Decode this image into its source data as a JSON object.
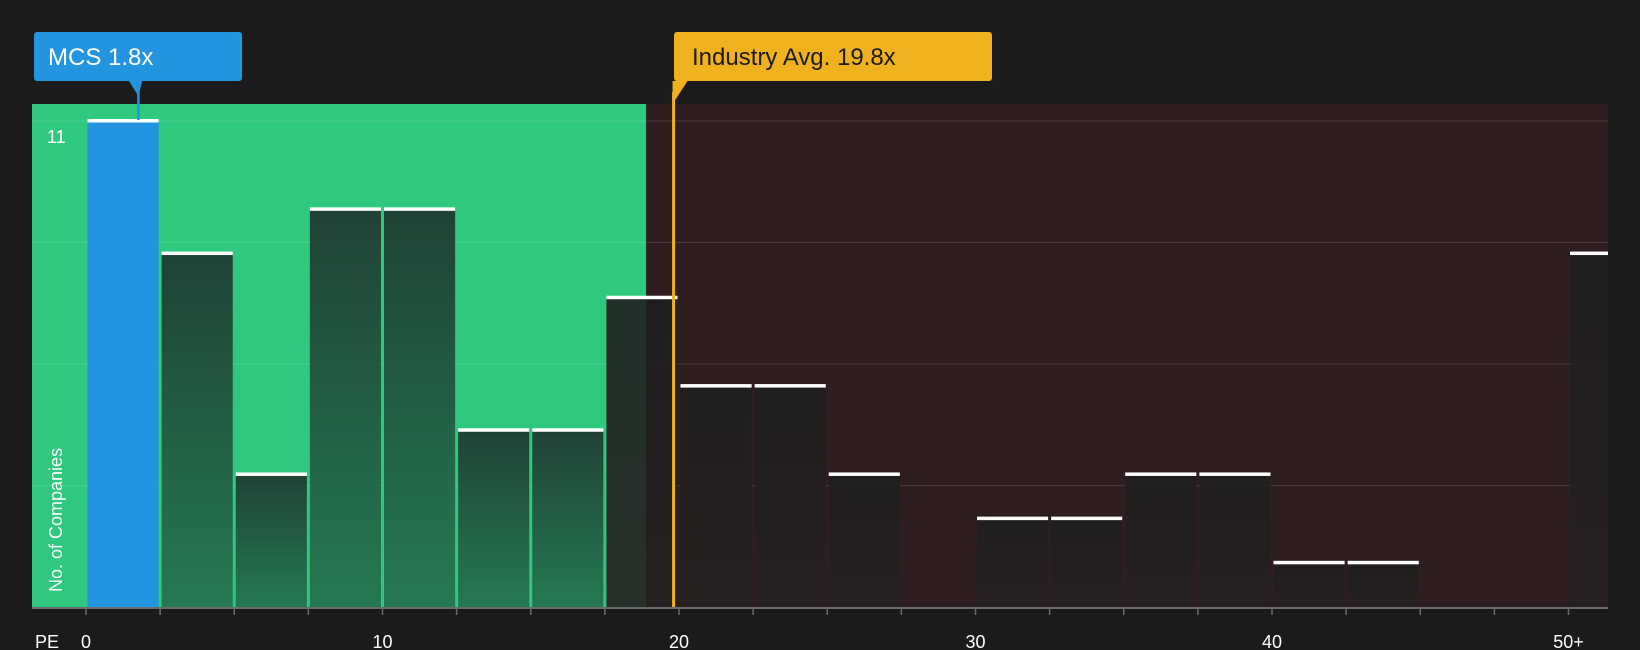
{
  "chart_data": {
    "type": "bar",
    "title": "",
    "xlabel": "PE",
    "ylabel": "No. of Companies",
    "x_tick_labels": [
      "0",
      "10",
      "20",
      "30",
      "40",
      "50+"
    ],
    "x_tick_values": [
      0,
      10,
      20,
      30,
      40,
      50
    ],
    "y_max_label": "11",
    "ylim": [
      0,
      11
    ],
    "bin_width": 2.5,
    "bins": [
      {
        "start": 0,
        "value": 11
      },
      {
        "start": 2.5,
        "value": 8
      },
      {
        "start": 5,
        "value": 3
      },
      {
        "start": 7.5,
        "value": 9
      },
      {
        "start": 10,
        "value": 9
      },
      {
        "start": 12.5,
        "value": 4
      },
      {
        "start": 15,
        "value": 4
      },
      {
        "start": 17.5,
        "value": 7
      },
      {
        "start": 20,
        "value": 5
      },
      {
        "start": 22.5,
        "value": 5
      },
      {
        "start": 25,
        "value": 3
      },
      {
        "start": 27.5,
        "value": 0
      },
      {
        "start": 30,
        "value": 2
      },
      {
        "start": 32.5,
        "value": 2
      },
      {
        "start": 35,
        "value": 3
      },
      {
        "start": 37.5,
        "value": 3
      },
      {
        "start": 40,
        "value": 1
      },
      {
        "start": 42.5,
        "value": 1
      },
      {
        "start": 45,
        "value": 0
      },
      {
        "start": 47.5,
        "value": 0
      },
      {
        "start": 50,
        "value": 8
      }
    ],
    "highlight_bin_start": 0,
    "company": {
      "label": "MCS 1.8x",
      "value": 1.8
    },
    "industry_avg": {
      "label": "Industry Avg. 19.8x",
      "value": 19.8
    },
    "grid": true,
    "colors": {
      "background": "#1b1b1b",
      "good_zone": "#2ec87e",
      "bad_zone": "#2f1e1f",
      "highlight_bar": "#2394e0",
      "industry_line": "#efb21e",
      "bar_cap": "#ffffff"
    }
  }
}
